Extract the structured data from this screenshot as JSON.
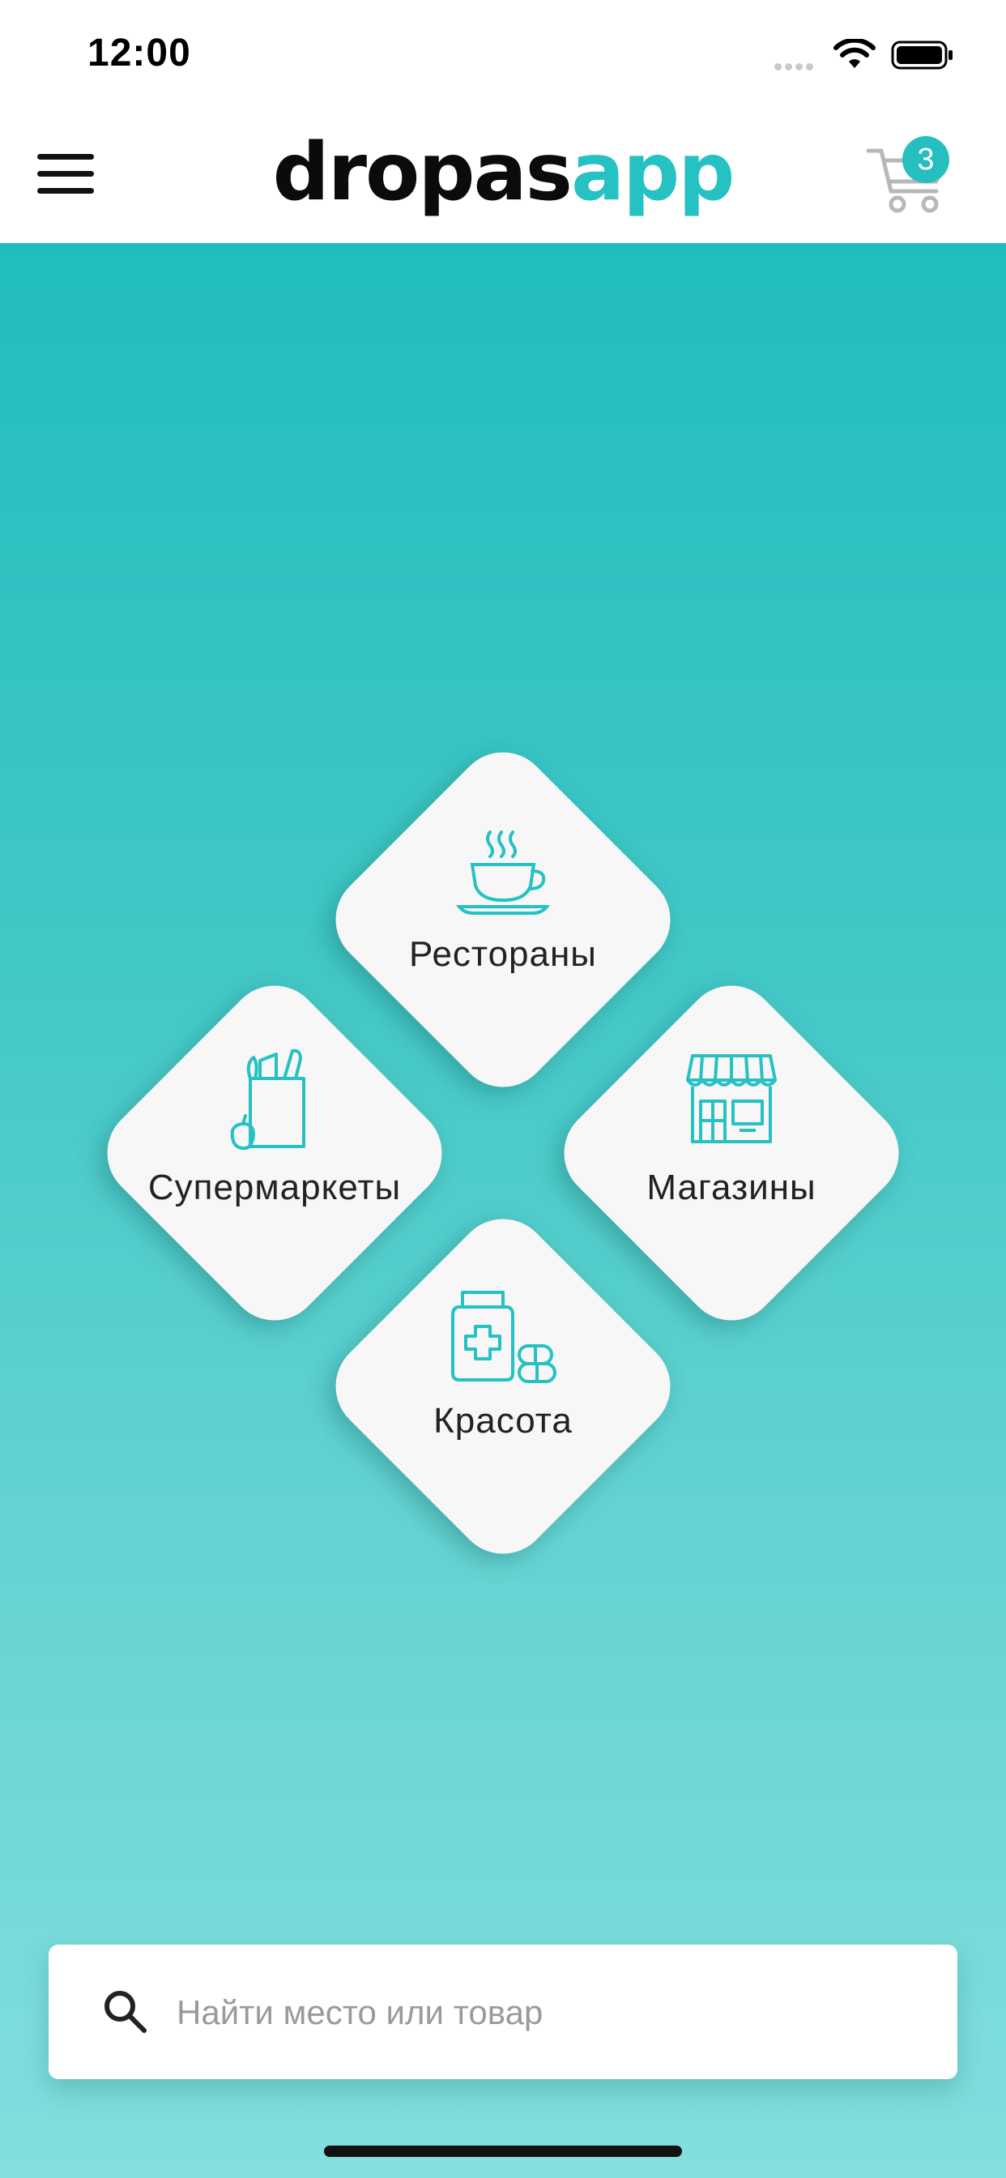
{
  "status_bar": {
    "time": "12:00"
  },
  "header": {
    "logo_dark": "dropas",
    "logo_accent": "app",
    "cart_count": "3"
  },
  "categories": [
    {
      "label": "Рестораны",
      "icon": "coffee-cup-icon"
    },
    {
      "label": "Супермаркеты",
      "icon": "grocery-bag-icon"
    },
    {
      "label": "Магазины",
      "icon": "storefront-icon"
    },
    {
      "label": "Красота",
      "icon": "medicine-jar-icon"
    }
  ],
  "search": {
    "placeholder": "Найти место или товар"
  },
  "colors": {
    "accent": "#26c1c2",
    "tile": "#f7f7f7",
    "gradient_top": "#21bdbd",
    "gradient_bottom": "#84dede"
  }
}
